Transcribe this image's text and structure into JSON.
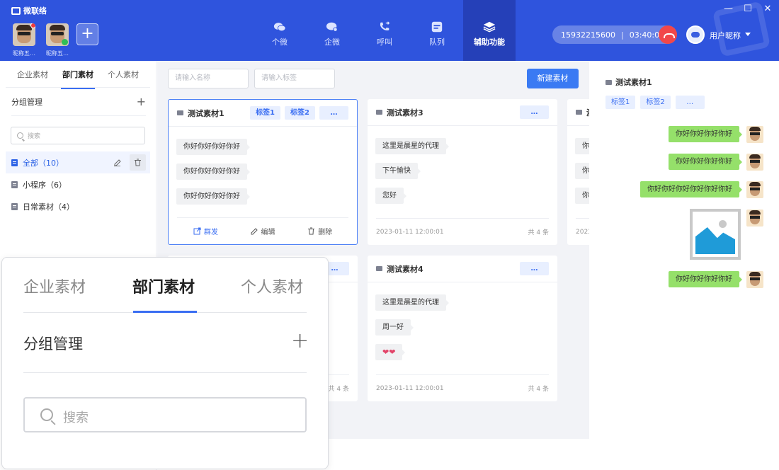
{
  "app": {
    "name": "微联络"
  },
  "window_controls": [
    "—",
    "☐",
    "✕"
  ],
  "accounts": [
    {
      "label": "昵称五…",
      "badge": "unread"
    },
    {
      "label": "昵称五…",
      "badge": "wechat"
    }
  ],
  "nav": [
    {
      "label": "个微",
      "icon": "wechat-icon"
    },
    {
      "label": "企微",
      "icon": "work-wechat-icon"
    },
    {
      "label": "呼叫",
      "icon": "phone-call-icon"
    },
    {
      "label": "队列",
      "icon": "queue-icon"
    },
    {
      "label": "辅助功能",
      "icon": "layers-icon",
      "active": true
    }
  ],
  "call": {
    "number": "15932215600",
    "sep": "|",
    "duration": "03:40:02"
  },
  "user": {
    "name": "用户昵称"
  },
  "left": {
    "tabs": [
      "企业素材",
      "部门素材",
      "个人素材"
    ],
    "group_title": "分组管理",
    "plus": "+",
    "search_placeholder": "搜索",
    "groups": [
      {
        "label": "全部（10）",
        "active": true
      },
      {
        "label": "小程序（6）"
      },
      {
        "label": "日常素材（4）"
      }
    ]
  },
  "center": {
    "name_placeholder": "请输入名称",
    "tag_placeholder": "请输入标签",
    "new_button": "新建素材",
    "cards": [
      {
        "title": "测试素材1",
        "tags": [
          "标签1",
          "标签2"
        ],
        "more": "…",
        "messages": [
          "你好你好你好你好",
          "你好你好你好你好",
          "你好你好你好你好"
        ],
        "actions": [
          "群发",
          "编辑",
          "删除"
        ]
      },
      {
        "title": "测试素材3",
        "more": "…",
        "messages": [
          "这里是晨星的代理",
          "下午愉快",
          "您好"
        ],
        "date": "2023-01-11 12:00:01",
        "count": "共 4 条"
      },
      {
        "title": "测",
        "more": "…",
        "messages": [
          "你",
          "你",
          "你"
        ],
        "date": "2023"
      },
      {
        "title": "",
        "more": "…",
        "count": "共 4 条"
      },
      {
        "title": "测试素材4",
        "more": "…",
        "messages": [
          "这里是晨星的代理",
          "周一好",
          "❤❤"
        ],
        "date": "2023-01-11 12:00:01",
        "count": "共 4 条"
      }
    ]
  },
  "right": {
    "title": "测试素材1",
    "tags": [
      "标签1",
      "标签2"
    ],
    "more": "…",
    "messages": [
      "你好你好你好你好",
      "你好你好你好你好",
      "你好你好你好你好你好你好",
      "你好你好你好你好"
    ]
  },
  "zoom": {
    "tabs": [
      "企业素材",
      "部门素材",
      "个人素材"
    ],
    "group_title": "分组管理",
    "plus": "+",
    "search_placeholder": "搜索"
  },
  "colors": {
    "accent": "#2f54dd",
    "primary": "#3a7af3",
    "bubble_green": "#95e06a"
  }
}
